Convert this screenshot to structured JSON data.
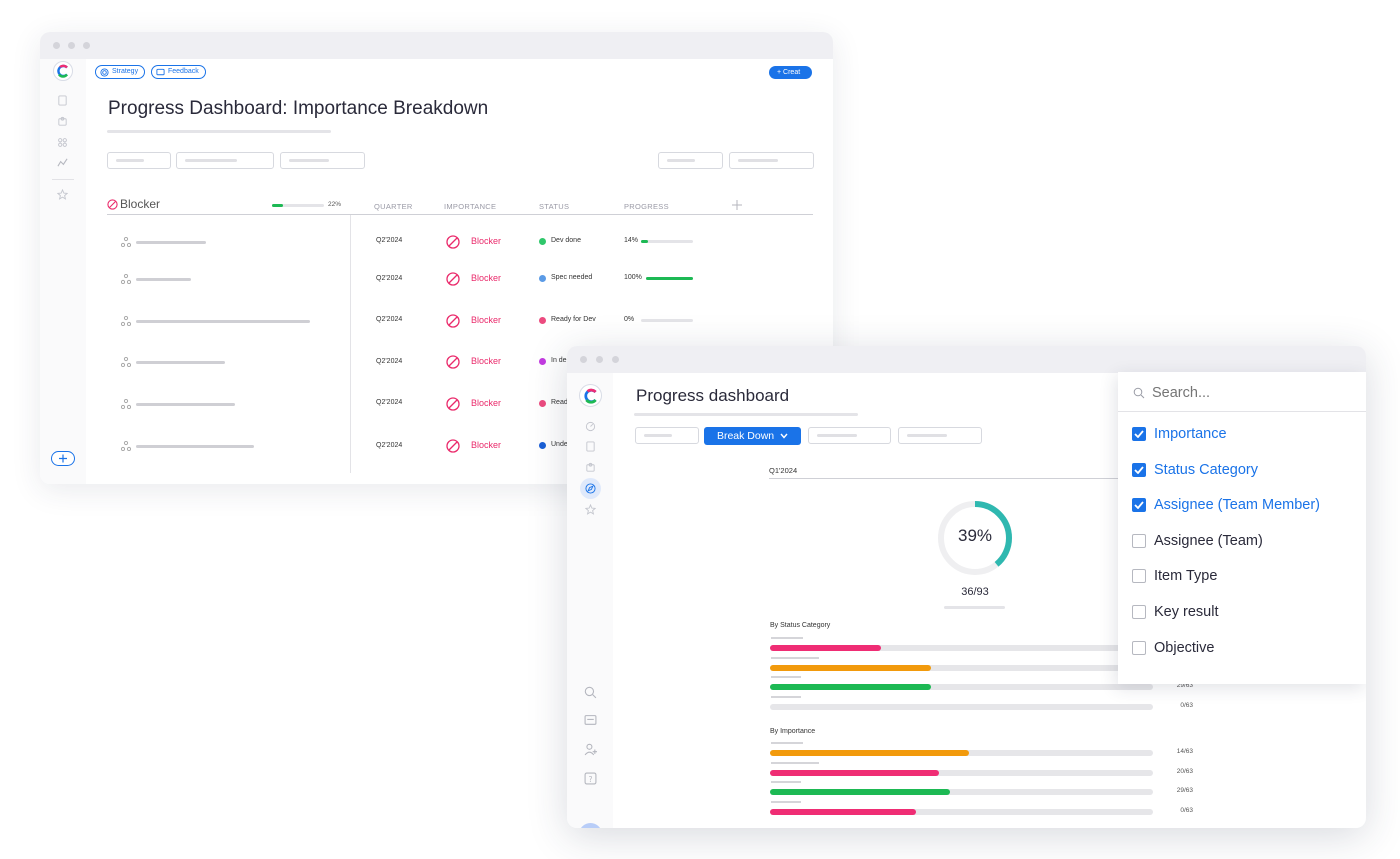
{
  "colors": {
    "accent": "#1a73e8",
    "blocker": "#ea2a6b",
    "green": "#1db954",
    "orange": "#f29a0c",
    "pink": "#ef2d74",
    "teal": "#2fb8b0"
  },
  "back_window": {
    "toolbar": {
      "strategy_label": "Strategy",
      "feedback_label": "Feedback",
      "create_label": "Creat"
    },
    "title": "Progress Dashboard: Importance Breakdown",
    "group": {
      "name": "Blocker",
      "progress_percent": 22,
      "progress_label": "22%"
    },
    "columns": [
      "QUARTER",
      "IMPORTANCE",
      "STATUS",
      "PROGRESS"
    ],
    "add_column_icon": "plus-icon",
    "rows": [
      {
        "quarter": "Q2'2024",
        "importance": "Blocker",
        "status": "Dev done",
        "status_color": "#2fc76b",
        "progress_label": "14%",
        "progress": 0.14
      },
      {
        "quarter": "Q2'2024",
        "importance": "Blocker",
        "status": "Spec needed",
        "status_color": "#5b9be6",
        "progress_label": "100%",
        "progress": 1.0
      },
      {
        "quarter": "Q2'2024",
        "importance": "Blocker",
        "status": "Ready for Dev",
        "status_color": "#ec4b7f",
        "progress_label": "0%",
        "progress": 0
      },
      {
        "quarter": "Q2'2024",
        "importance": "Blocker",
        "status": "In de",
        "status_color": "#c23be0",
        "progress_label": "",
        "progress": null
      },
      {
        "quarter": "Q2'2024",
        "importance": "Blocker",
        "status": "Read",
        "status_color": "#ec4b7f",
        "progress_label": "",
        "progress": null
      },
      {
        "quarter": "Q2'2024",
        "importance": "Blocker",
        "status": "Unde",
        "status_color": "#1a5fd6",
        "progress_label": "",
        "progress": null
      }
    ]
  },
  "front_window": {
    "title": "Progress dashboard",
    "breakdown_label": "Break Down",
    "quarter": "Q1'2024",
    "donut": {
      "percent": 39,
      "label": "39%",
      "done": 36,
      "total": 93,
      "fraction_label": "36/93"
    },
    "by_status": {
      "heading": "By Status Category",
      "bars": [
        {
          "color": "#ef2d74",
          "fraction": 0.29,
          "count_label": ""
        },
        {
          "color": "#f29a0c",
          "fraction": 0.42,
          "count_label": ""
        },
        {
          "color": "#1db954",
          "fraction": 0.42,
          "count_label": "29/63"
        },
        {
          "color": "#ef2d74",
          "fraction": 0,
          "count_label": "0/63"
        }
      ]
    },
    "by_importance": {
      "heading": "By Importance",
      "bars": [
        {
          "color": "#f29a0c",
          "fraction": 0.52,
          "count_label": "14/63"
        },
        {
          "color": "#ef2d74",
          "fraction": 0.44,
          "count_label": "20/63"
        },
        {
          "color": "#1db954",
          "fraction": 0.47,
          "count_label": "29/63"
        },
        {
          "color": "#ef2d74",
          "fraction": 0.38,
          "count_label": "0/63"
        }
      ]
    },
    "dropdown": {
      "search_placeholder": "Search...",
      "options": [
        {
          "label": "Importance",
          "checked": true
        },
        {
          "label": "Status Category",
          "checked": true
        },
        {
          "label": "Assignee (Team Member)",
          "checked": true
        },
        {
          "label": "Assignee (Team)",
          "checked": false
        },
        {
          "label": "Item Type",
          "checked": false
        },
        {
          "label": "Key result",
          "checked": false
        },
        {
          "label": "Objective",
          "checked": false
        }
      ]
    }
  }
}
